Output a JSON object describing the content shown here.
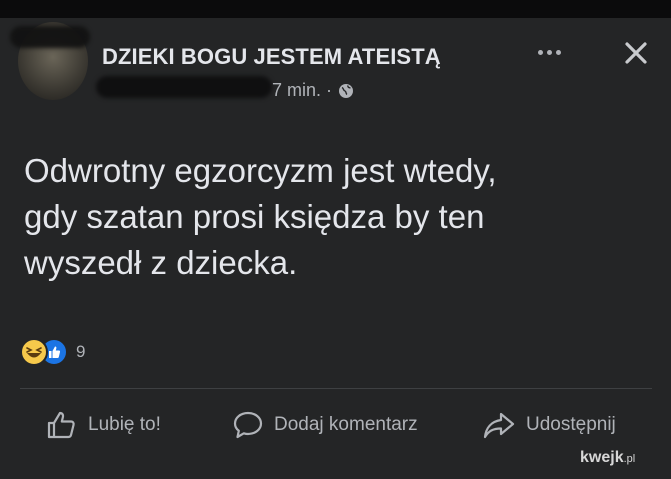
{
  "post": {
    "group_name": "DZIEKI BOGU JESTEM ATEISTĄ",
    "timestamp": "7 min. ·",
    "privacy_icon": "globe-icon",
    "text": "Odwrotny egzorcyzm jest wtedy,\ngdy szatan prosi księdza by ten\nwyszedł z dziecka.",
    "reaction_icons": [
      "haha-icon",
      "like-icon"
    ],
    "reaction_count": "9"
  },
  "header_icons": [
    "more-icon",
    "close-icon"
  ],
  "actions": {
    "like_label": "Lubię to!",
    "comment_label": "Dodaj komentarz",
    "share_label": "Udostępnij"
  },
  "watermark": {
    "brand": "kwejk",
    "tld": ".pl"
  },
  "colors": {
    "background": "#242526",
    "text_primary": "#e4e6eb",
    "text_secondary": "#b0b3b8",
    "like_blue": "#1b74e4",
    "haha_yellow": "#f7c94b"
  }
}
